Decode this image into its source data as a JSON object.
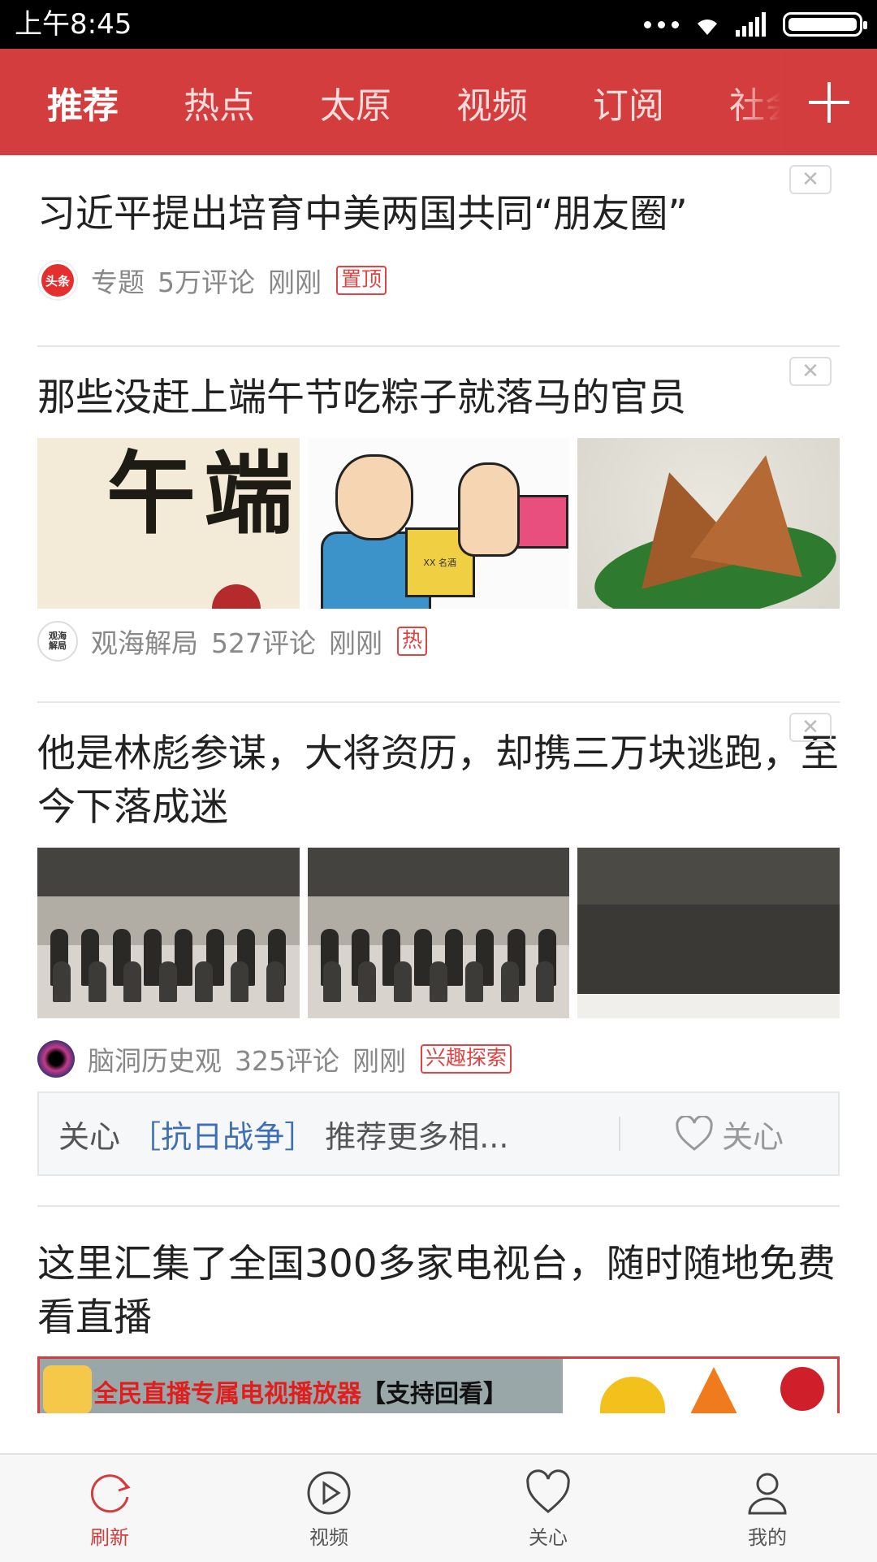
{
  "status": {
    "time": "上午8:45"
  },
  "tabs": [
    {
      "label": "推荐"
    },
    {
      "label": "热点"
    },
    {
      "label": "太原"
    },
    {
      "label": "视频"
    },
    {
      "label": "订阅"
    },
    {
      "label": "社会"
    }
  ],
  "articles": [
    {
      "title": "习近平提出培育中美两国共同“朋友圈”",
      "source": "专题",
      "source_avatar_text": "头条",
      "comments": "5万评论",
      "time": "刚刚",
      "tag": "置顶"
    },
    {
      "title": "那些没赶上端午节吃粽子就落马的官员",
      "source": "观海解局",
      "source_avatar_text": "观海解局",
      "comments": "527评论",
      "time": "刚刚",
      "tag": "热",
      "image1_text": "端午",
      "image2_box_text": "XX 名酒"
    },
    {
      "title": "他是林彪参谋，大将资历，却携三万块逃跑，至今下落成迷",
      "source": "脑洞历史观",
      "comments": "325评论",
      "time": "刚刚",
      "tag": "兴趣探索"
    },
    {
      "title": "这里汇集了全国300多家电视台，随时随地免费看直播"
    }
  ],
  "follow_box": {
    "prefix": "关心",
    "topic": "［抗日战争］",
    "suffix": "推荐更多相...",
    "button": "关心"
  },
  "ad": {
    "text": "全民直播专属电视播放器",
    "bracket": "【支持回看】"
  },
  "close_symbol": "✕",
  "bottom_nav": [
    {
      "label": "刷新",
      "icon": "refresh-icon"
    },
    {
      "label": "视频",
      "icon": "play-icon"
    },
    {
      "label": "关心",
      "icon": "heart-icon"
    },
    {
      "label": "我的",
      "icon": "user-icon"
    }
  ],
  "colors": {
    "brand": "#d43d3d",
    "link": "#3f6fb3"
  }
}
